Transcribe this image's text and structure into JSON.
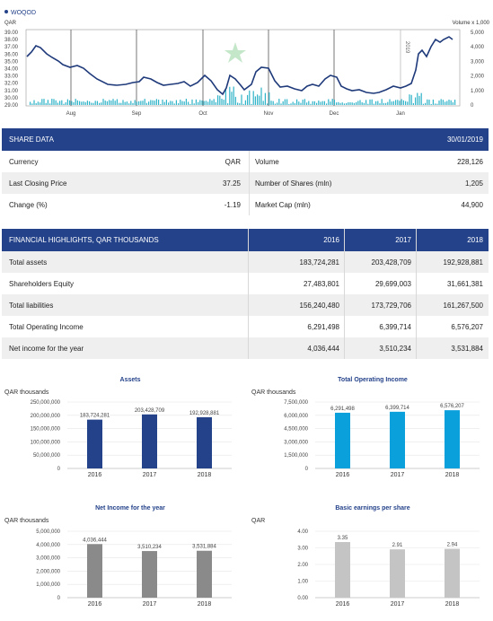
{
  "stock_chart": {
    "ticker": "WOQOD",
    "currency_label": "QAR",
    "volume_label": "Volume x 1,000",
    "y_ticks": [
      "39.00",
      "38.00",
      "37.00",
      "36.00",
      "35.00",
      "34.00",
      "33.00",
      "32.00",
      "31.00",
      "30.00",
      "29.00"
    ],
    "vol_ticks": [
      "5,000",
      "4,000",
      "3,000",
      "2,000",
      "1,000",
      "0"
    ],
    "months": [
      "Aug",
      "Sep",
      "Oct",
      "Nov",
      "Dec",
      "Jan"
    ],
    "year_marker": "2019",
    "line_color": "#1f3a7a",
    "volume_color": "#2fb3c9"
  },
  "share_data": {
    "title": "SHARE DATA",
    "date": "30/01/2019",
    "rows": [
      {
        "label": "Currency",
        "value": "QAR",
        "label2": "Volume",
        "value2": "228,126"
      },
      {
        "label": "Last Closing Price",
        "value": "37.25",
        "label2": "Number of Shares (mln)",
        "value2": "1,205"
      },
      {
        "label": "Change (%)",
        "value": "-1.19",
        "label2": "Market Cap (mln)",
        "value2": "44,900"
      }
    ]
  },
  "financial": {
    "title": "FINANCIAL HIGHLIGHTS, QAR THOUSANDS",
    "years": [
      "2016",
      "2017",
      "2018"
    ],
    "rows": [
      {
        "label": "Total assets",
        "values": [
          "183,724,281",
          "203,428,709",
          "192,928,881"
        ]
      },
      {
        "label": "Shareholders Equity",
        "values": [
          "27,483,801",
          "29,699,003",
          "31,661,381"
        ]
      },
      {
        "label": "Total liabilities",
        "values": [
          "156,240,480",
          "173,729,706",
          "161,267,500"
        ]
      },
      {
        "label": "Total Operating Income",
        "values": [
          "6,291,498",
          "6,399,714",
          "6,576,207"
        ]
      },
      {
        "label": "Net income for the year",
        "values": [
          "4,036,444",
          "3,510,234",
          "3,531,884"
        ]
      }
    ]
  },
  "chart_data": [
    {
      "type": "bar",
      "title": "Assets",
      "ylabel": "QAR thousands",
      "categories": [
        "2016",
        "2017",
        "2018"
      ],
      "values": [
        183724281,
        203428709,
        192928881
      ],
      "value_labels": [
        "183,724,281",
        "203,428,709",
        "192,928,881"
      ],
      "y_ticks": [
        "250,000,000",
        "200,000,000",
        "150,000,000",
        "100,000,000",
        "50,000,000",
        "0"
      ],
      "ylim": [
        0,
        250000000
      ],
      "color": "#24428a"
    },
    {
      "type": "bar",
      "title": "Total Operating Income",
      "ylabel": "QAR thousands",
      "categories": [
        "2016",
        "2017",
        "2018"
      ],
      "values": [
        6291498,
        6399714,
        6576207
      ],
      "value_labels": [
        "6,291,498",
        "6,399,714",
        "6,576,207"
      ],
      "y_ticks": [
        "7,500,000",
        "6,000,000",
        "4,500,000",
        "3,000,000",
        "1,500,000",
        "0"
      ],
      "ylim": [
        0,
        7500000
      ],
      "color": "#0aa0dc"
    },
    {
      "type": "bar",
      "title": "Net Income for the year",
      "ylabel": "QAR thousands",
      "categories": [
        "2016",
        "2017",
        "2018"
      ],
      "values": [
        4036444,
        3510234,
        3531884
      ],
      "value_labels": [
        "4,036,444",
        "3,510,234",
        "3,531,884"
      ],
      "y_ticks": [
        "5,000,000",
        "4,000,000",
        "3,000,000",
        "2,000,000",
        "1,000,000",
        "0"
      ],
      "ylim": [
        0,
        5000000
      ],
      "color": "#8a8a8a"
    },
    {
      "type": "bar",
      "title": "Basic earnings per share",
      "ylabel": "QAR",
      "categories": [
        "2016",
        "2017",
        "2018"
      ],
      "values": [
        3.35,
        2.91,
        2.94
      ],
      "value_labels": [
        "3.35",
        "2.91",
        "2.94"
      ],
      "y_ticks": [
        "4.00",
        "3.00",
        "2.00",
        "1.00",
        "0.00"
      ],
      "ylim": [
        0,
        4
      ],
      "color": "#c4c4c4"
    }
  ]
}
